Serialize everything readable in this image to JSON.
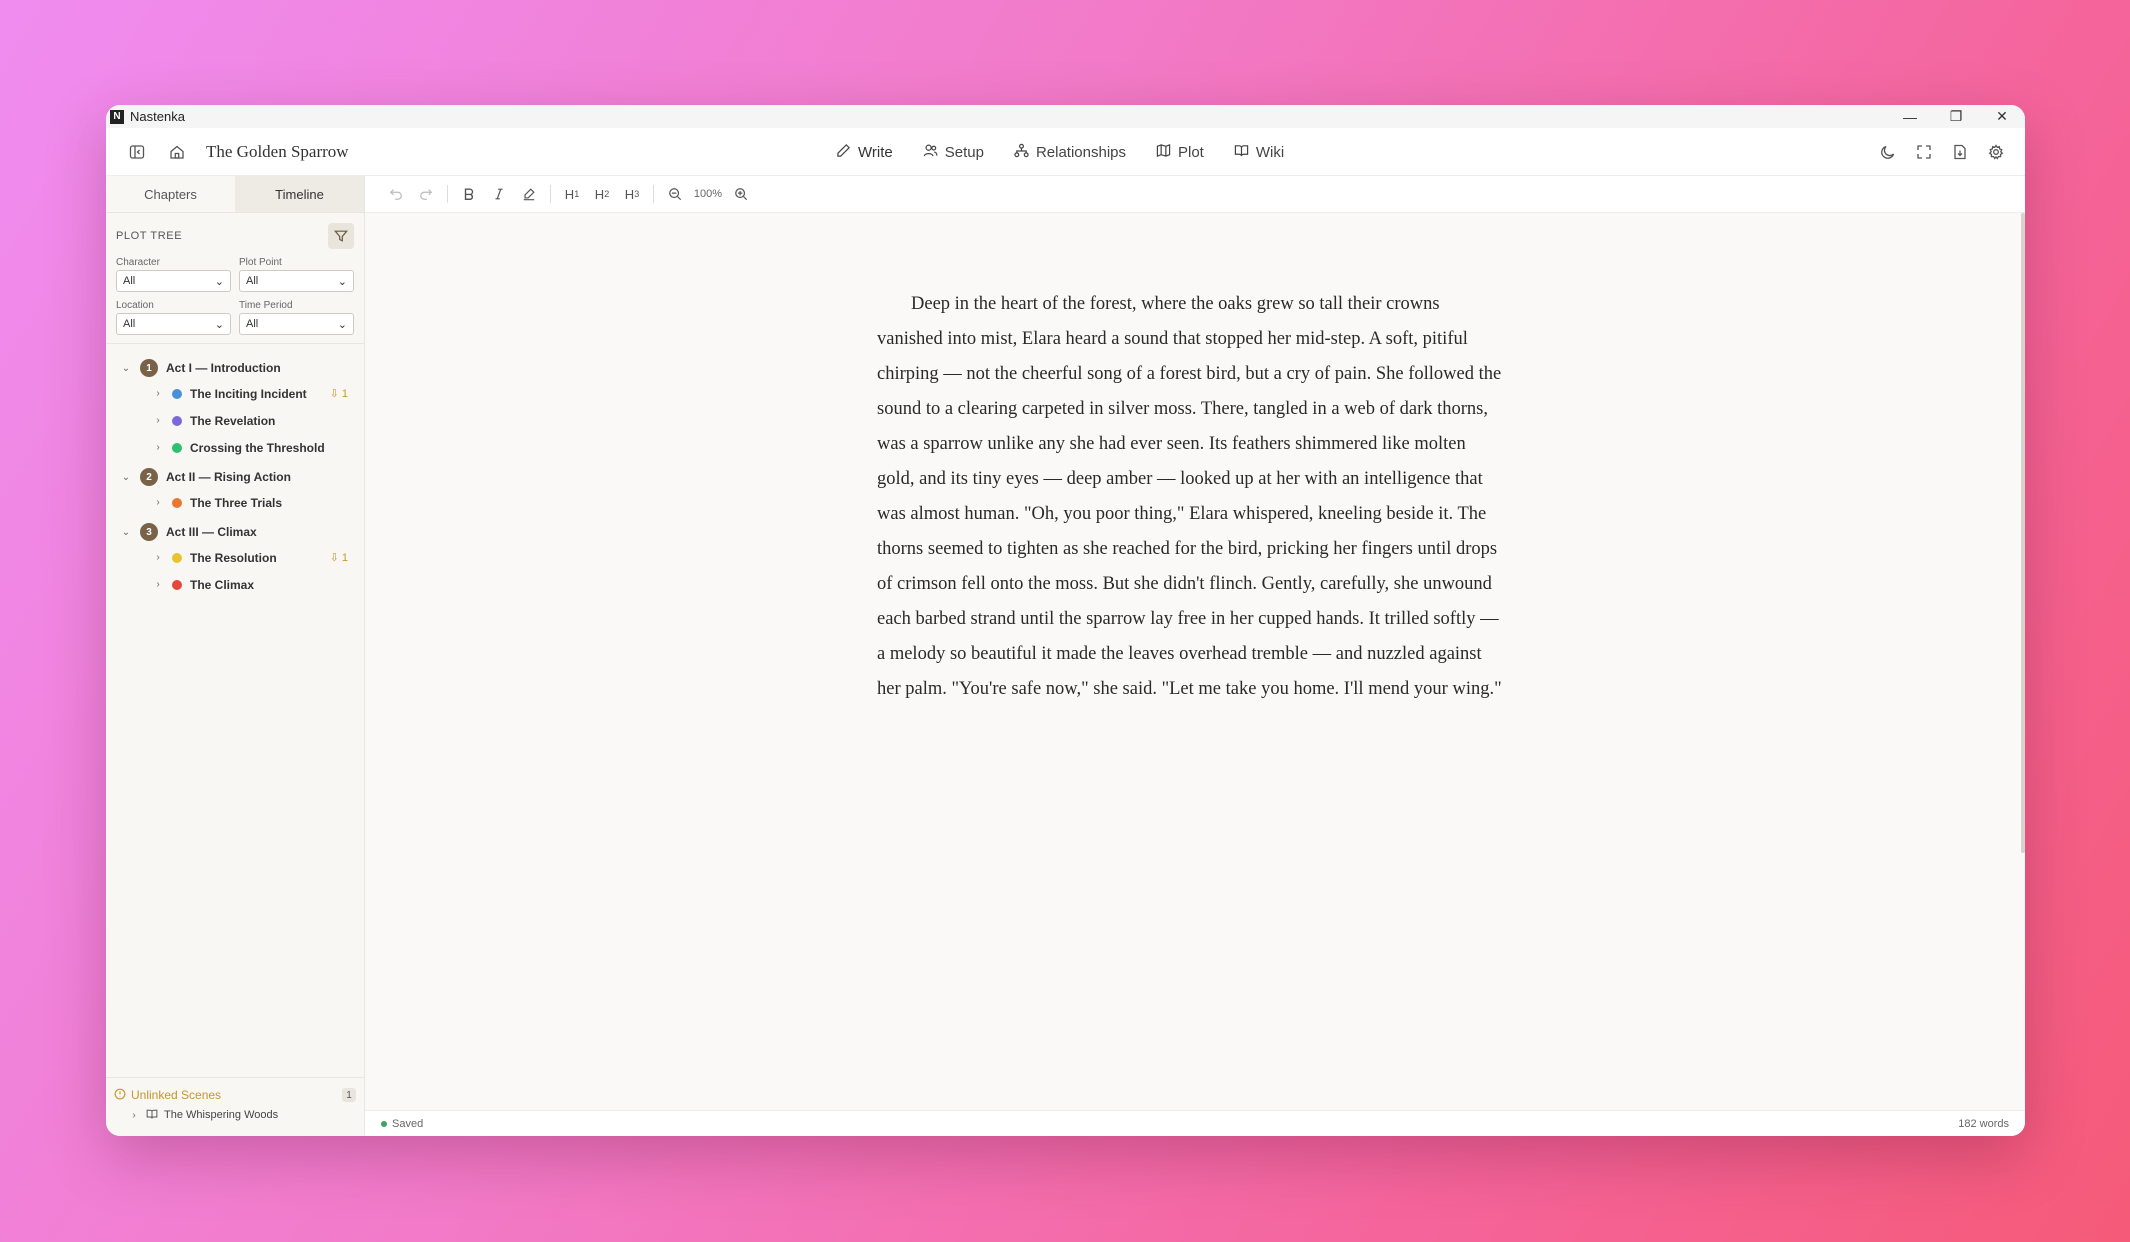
{
  "titlebar": {
    "app_name": "Nastenka",
    "logo_letter": "N",
    "minimize": "—",
    "restore": "❐",
    "close": "✕"
  },
  "header": {
    "project_title": "The Golden Sparrow",
    "nav": [
      {
        "label": "Write",
        "icon": "pencil-icon"
      },
      {
        "label": "Setup",
        "icon": "users-icon"
      },
      {
        "label": "Relationships",
        "icon": "network-icon"
      },
      {
        "label": "Plot",
        "icon": "map-icon"
      },
      {
        "label": "Wiki",
        "icon": "book-icon"
      }
    ]
  },
  "sidebar": {
    "tabs": [
      "Chapters",
      "Timeline"
    ],
    "active_tab": "Timeline",
    "plot_tree_label": "PLOT TREE",
    "filters": [
      {
        "label": "Character",
        "value": "All"
      },
      {
        "label": "Plot Point",
        "value": "All"
      },
      {
        "label": "Location",
        "value": "All"
      },
      {
        "label": "Time Period",
        "value": "All"
      }
    ],
    "acts": [
      {
        "number": "1",
        "title": "Act I — Introduction",
        "scenes": [
          {
            "title": "The Inciting Incident",
            "color": "#4a90d9",
            "badge": "⇩ 1"
          },
          {
            "title": "The Revelation",
            "color": "#7b68d9",
            "badge": ""
          },
          {
            "title": "Crossing the Threshold",
            "color": "#2fbf71",
            "badge": ""
          }
        ]
      },
      {
        "number": "2",
        "title": "Act II — Rising Action",
        "scenes": [
          {
            "title": "The Three Trials",
            "color": "#e8782f",
            "badge": ""
          }
        ]
      },
      {
        "number": "3",
        "title": "Act III — Climax",
        "scenes": [
          {
            "title": "The Resolution",
            "color": "#e8c32f",
            "badge": "⇩ 1"
          },
          {
            "title": "The Climax",
            "color": "#e5483a",
            "badge": ""
          }
        ]
      }
    ],
    "unlinked": {
      "title": "Unlinked Scenes",
      "count": "1",
      "items": [
        "The Whispering Woods"
      ]
    }
  },
  "toolbar": {
    "zoom": "100%",
    "h1": "H",
    "h1_sub": "1",
    "h2": "H",
    "h2_sub": "2",
    "h3": "H",
    "h3_sub": "3"
  },
  "document": {
    "text": "Deep in the heart of the forest, where the oaks grew so tall their crowns vanished into mist, Elara heard a sound that stopped her mid-step. A soft, pitiful chirping — not the cheerful song of a forest bird, but a cry of pain. She followed the sound to a clearing carpeted in silver moss. There, tangled in a web of dark thorns, was a sparrow unlike any she had ever seen. Its feathers shimmered like molten gold, and its tiny eyes — deep amber — looked up at her with an intelligence that was almost human. \"Oh, you poor thing,\" Elara whispered, kneeling beside it. The thorns seemed to tighten as she reached for the bird, pricking her fingers until drops of crimson fell onto the moss. But she didn't flinch. Gently, carefully, she unwound each barbed strand until the sparrow lay free in her cupped hands. It trilled softly — a melody so beautiful it made the leaves overhead tremble — and nuzzled against her palm. \"You're safe now,\" she said. \"Let me take you home. I'll mend your wing.\""
  },
  "status": {
    "saved": "Saved",
    "word_count": "182 words"
  }
}
